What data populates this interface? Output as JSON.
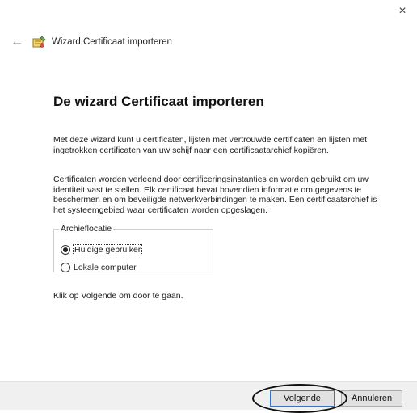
{
  "window": {
    "title": "Wizard Certificaat importeren",
    "close_glyph": "×",
    "back_glyph": "←"
  },
  "content": {
    "heading": "De wizard Certificaat importeren",
    "paragraph1": "Met deze wizard kunt u certificaten, lijsten met vertrouwde certificaten en lijsten met ingetrokken certificaten van uw schijf naar een certificaatarchief kopiëren.",
    "paragraph2": "Certificaten worden verleend door certificeringsinstanties en worden gebruikt om uw identiteit vast te stellen. Elk certificaat bevat bovendien informatie om gegevens te beschermen en om beveiligde netwerkverbindingen te maken. Een certificaatarchief is het systeemgebied waar certificaten worden opgeslagen.",
    "store_location": {
      "legend": "Archieflocatie",
      "options": [
        {
          "label": "Huidige gebruiker",
          "selected": true
        },
        {
          "label": "Lokale computer",
          "selected": false
        }
      ]
    },
    "paragraph3": "Klik op Volgende om door te gaan."
  },
  "footer": {
    "next_label": "Volgende",
    "cancel_label": "Annuleren"
  },
  "colors": {
    "footer_bg": "#f0f0f0",
    "button_bg": "#e1e1e1",
    "default_button_border": "#3a72c6"
  },
  "icons": {
    "app": "certificate-wizard-icon",
    "back": "back-arrow-icon",
    "close": "close-icon"
  }
}
